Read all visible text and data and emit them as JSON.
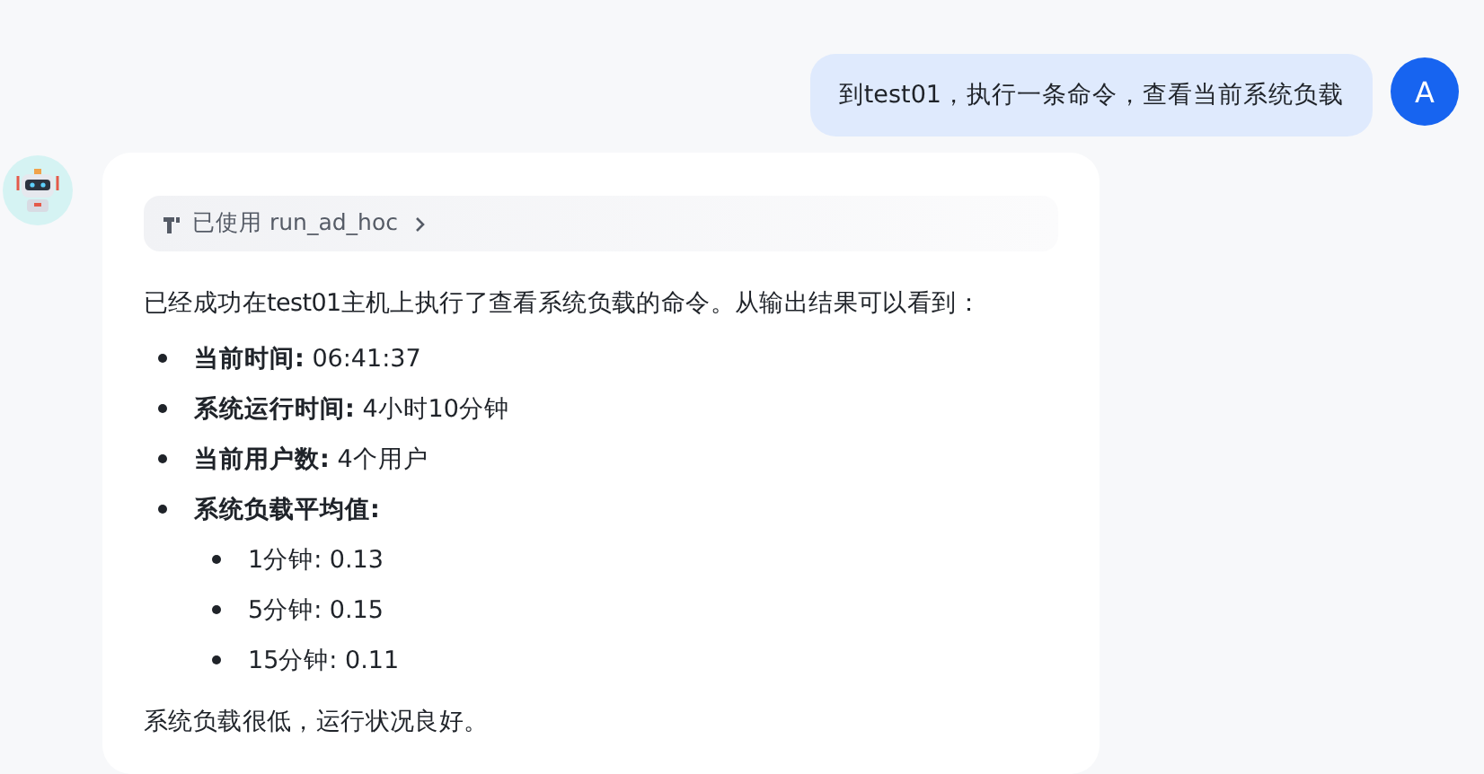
{
  "user_message": {
    "text": "到test01，执行一条命令，查看当前系统负载",
    "avatar_letter": "A"
  },
  "assistant_message": {
    "tool_chip": {
      "label": "已使用 run_ad_hoc",
      "expanded": false
    },
    "intro": "已经成功在test01主机上执行了查看系统负载的命令。从输出结果可以看到：",
    "items": [
      {
        "text": "**当前时间:** 06:41:37"
      },
      {
        "text": "**系统运行时间:** 4小时10分钟"
      },
      {
        "text": "**当前用户数:** 4个用户"
      },
      {
        "text": "**系统负载平均值:**",
        "children": [
          {
            "text": "1分钟: 0.13"
          },
          {
            "text": "5分钟: 0.15"
          },
          {
            "text": "15分钟: 0.11"
          }
        ]
      }
    ],
    "conclusion": "系统负载很低，运行状况良好。"
  }
}
